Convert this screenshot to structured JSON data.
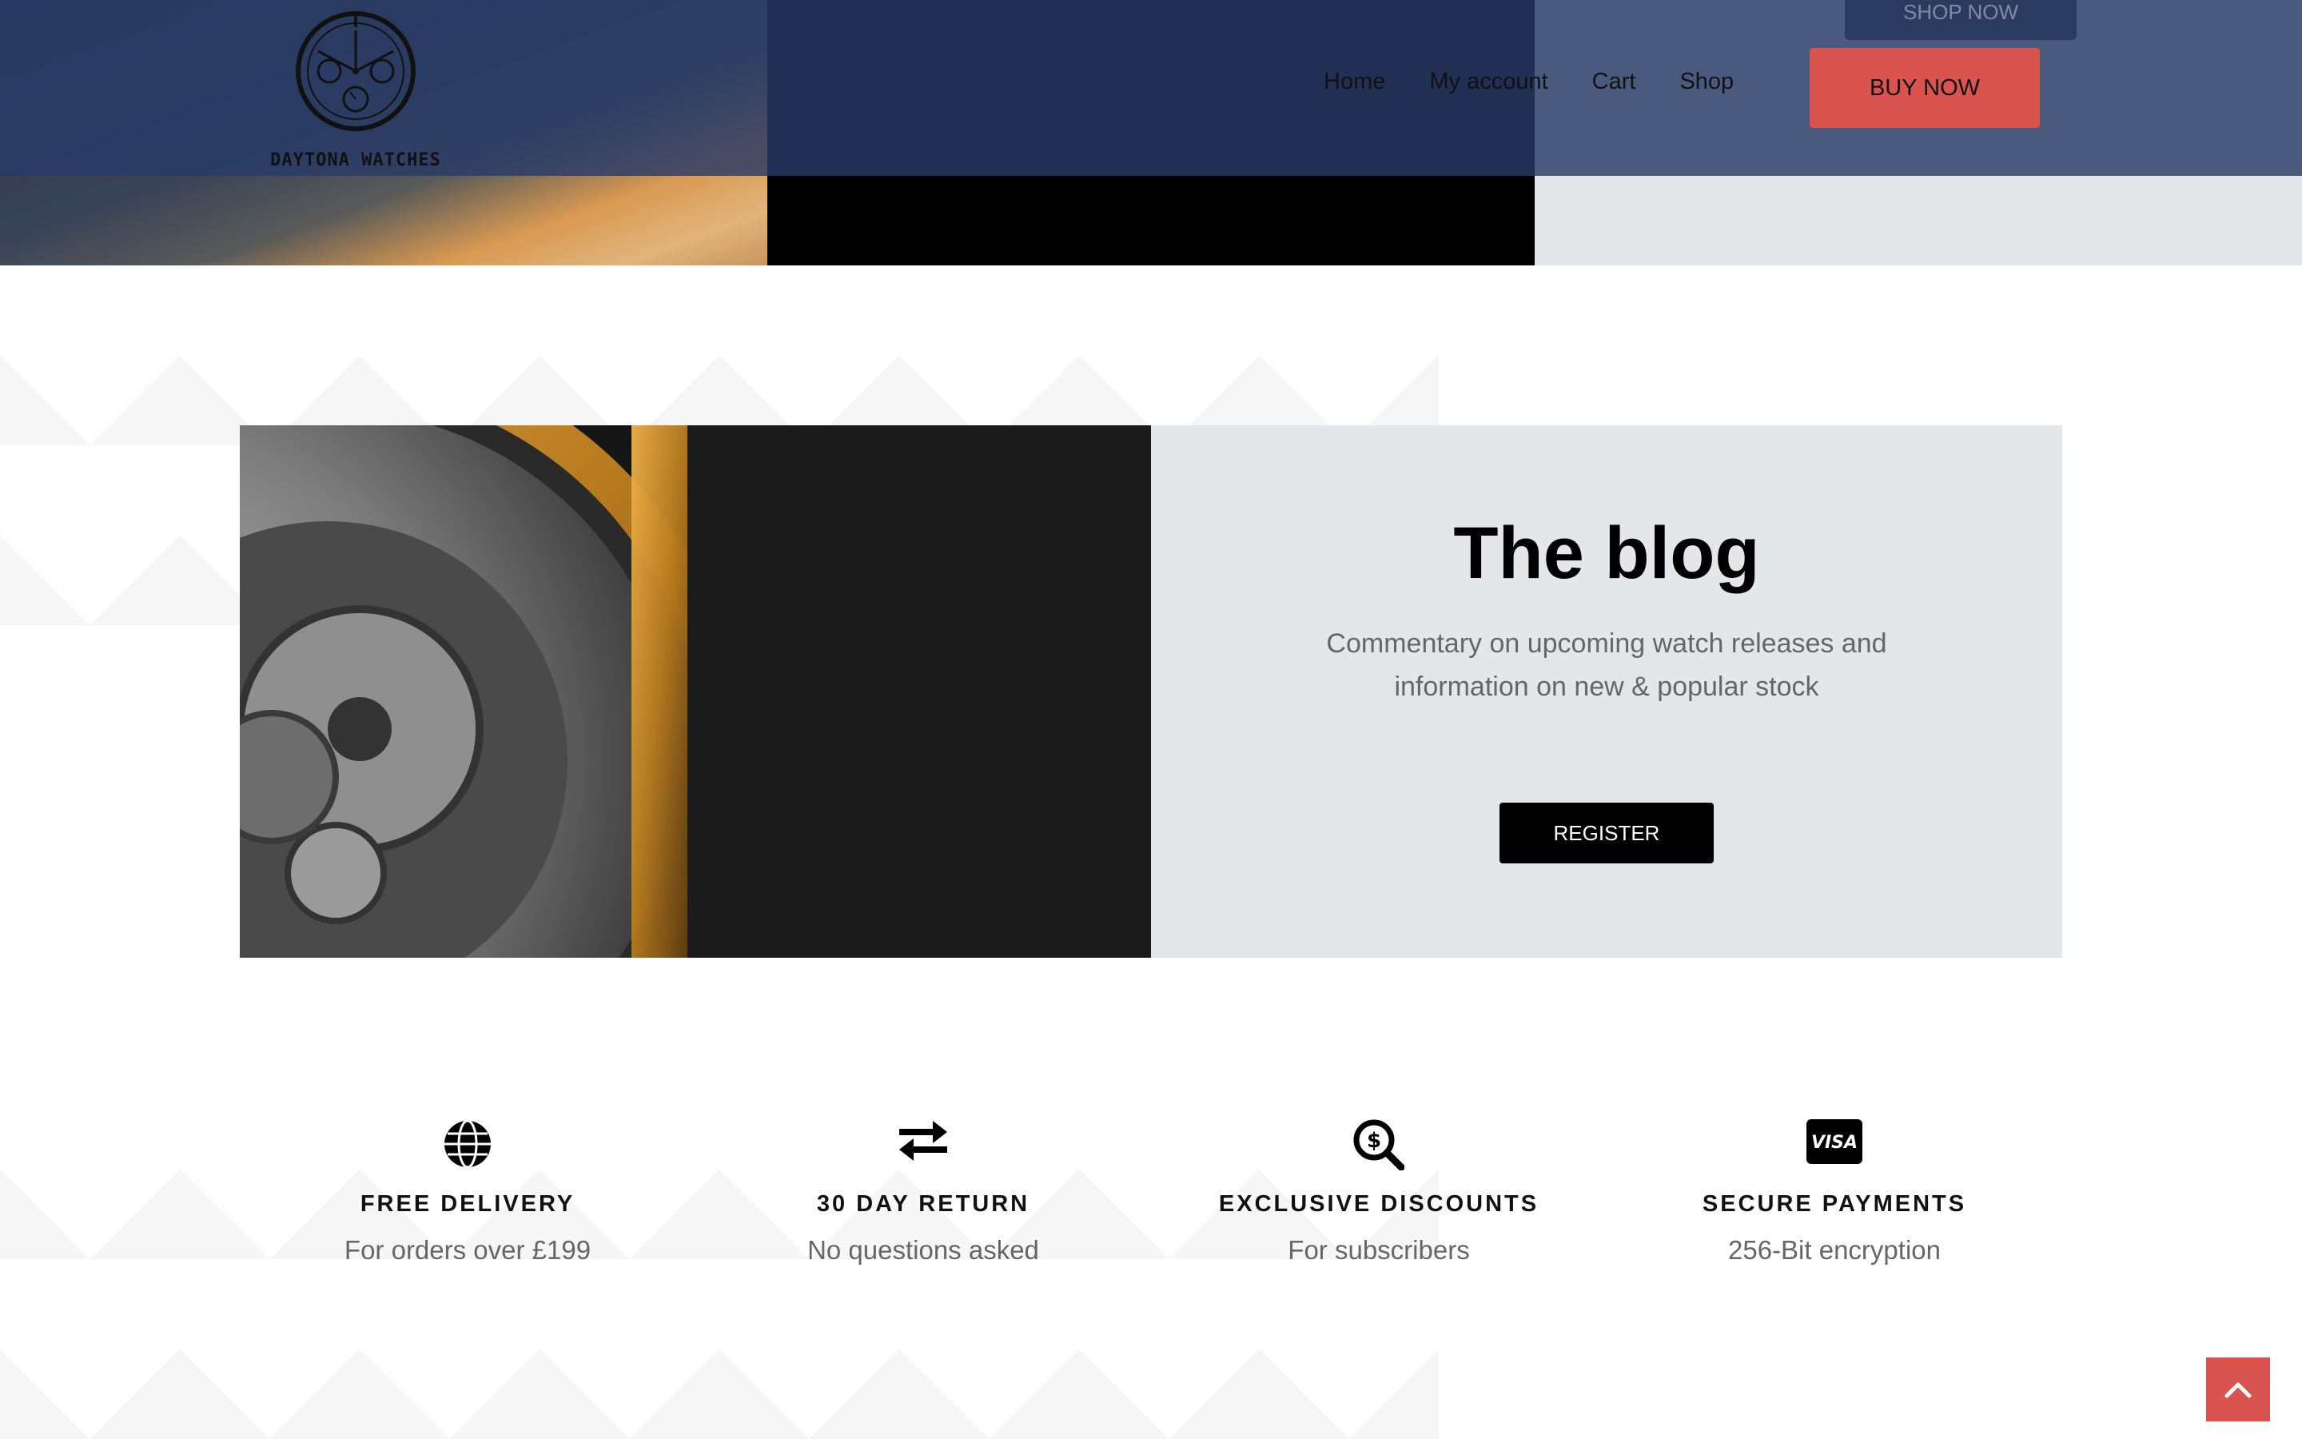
{
  "header": {
    "logo_text": "DAYTONA WATCHES",
    "ghost_button": "SHOP NOW",
    "nav": [
      "Home",
      "My account",
      "Cart",
      "Shop"
    ],
    "cta": "BUY NOW"
  },
  "blog": {
    "title": "The blog",
    "description": "Commentary on upcoming watch releases and information on new & popular stock",
    "button": "REGISTER"
  },
  "features": [
    {
      "icon": "globe-icon",
      "title": "FREE DELIVERY",
      "subtitle": "For orders over £199"
    },
    {
      "icon": "exchange-arrows-icon",
      "title": "30 DAY RETURN",
      "subtitle": "No questions asked"
    },
    {
      "icon": "search-dollar-icon",
      "title": "EXCLUSIVE DISCOUNTS",
      "subtitle": "For subscribers"
    },
    {
      "icon": "visa-card-icon",
      "title": "SECURE PAYMENTS",
      "subtitle": "256-Bit encryption"
    }
  ],
  "colors": {
    "header_bg": "#283a66",
    "accent_red": "#d9534f",
    "panel_grey": "#e3e7ea",
    "black": "#000000"
  },
  "scroll_top_icon": "chevron-up-icon"
}
